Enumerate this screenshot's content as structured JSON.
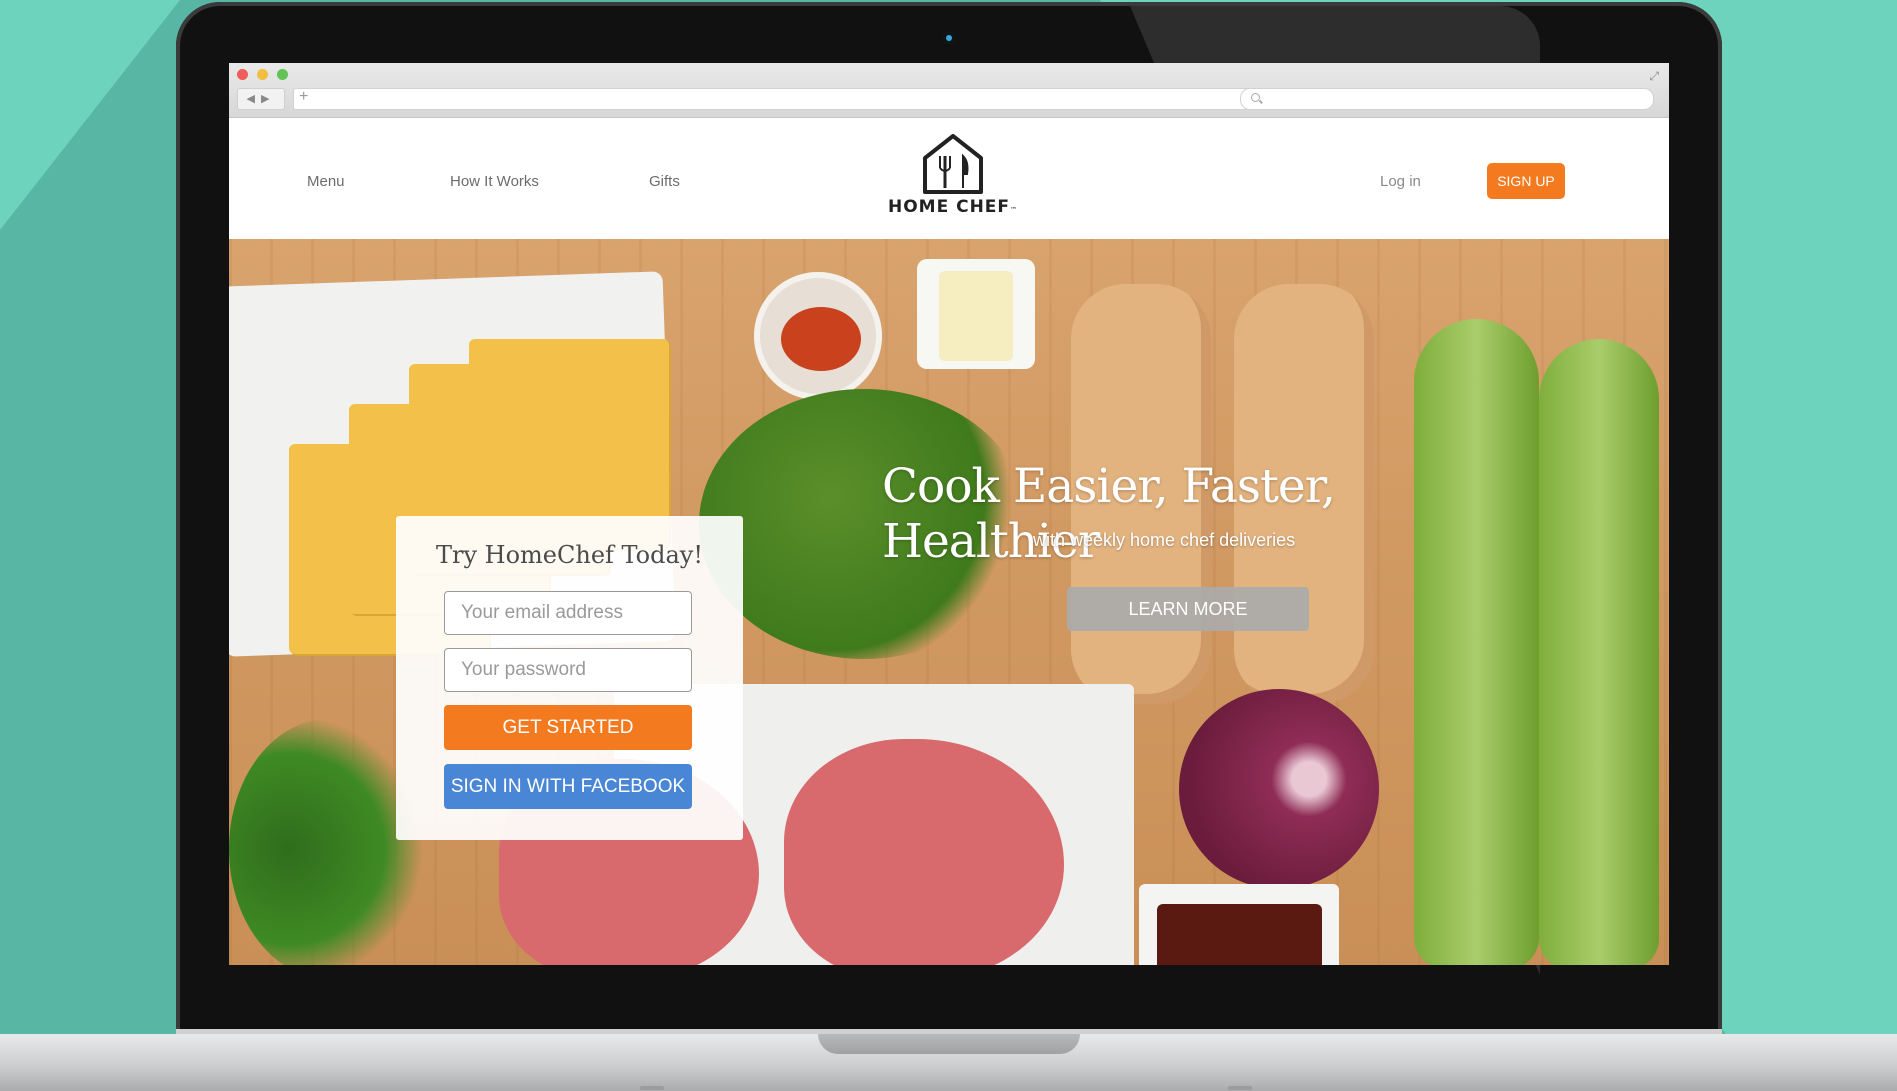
{
  "browser": {
    "address_value": "",
    "search_value": ""
  },
  "nav": {
    "items": [
      {
        "label": "Menu"
      },
      {
        "label": "How It Works"
      },
      {
        "label": "Gifts"
      }
    ],
    "login_label": "Log in",
    "signup_label": "SIGN UP"
  },
  "brand": {
    "name": "HOME CHEF",
    "trademark": "™"
  },
  "hero": {
    "title": "Cook Easier, Faster, Healthier",
    "subtitle": "with weekly home chef deliveries",
    "cta_label": "LEARN MORE"
  },
  "signup_card": {
    "title": "Try HomeChef Today!",
    "email_placeholder": "Your email address",
    "password_placeholder": "Your password",
    "primary_button": "GET STARTED",
    "facebook_button": "SIGN IN WITH FACEBOOK"
  },
  "colors": {
    "background": "#6dd3bd",
    "accent_orange": "#f47a20",
    "facebook_blue": "#4a86d6"
  }
}
